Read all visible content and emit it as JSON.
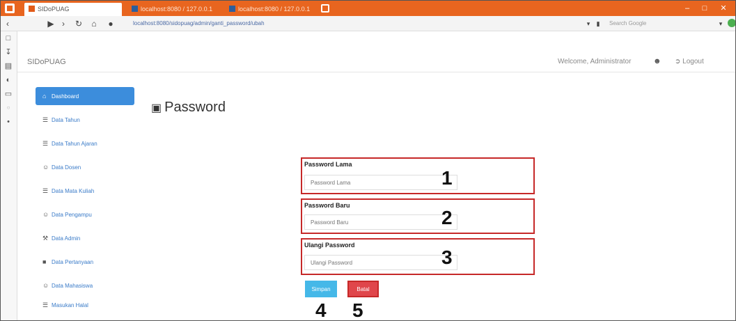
{
  "browser": {
    "tabs": [
      {
        "label": "SIDoPUAG",
        "active": true
      },
      {
        "label": "localhost:8080 / 127.0.0.1",
        "active": false
      },
      {
        "label": "localhost:8080 / 127.0.0.1",
        "active": false
      }
    ],
    "url": "localhost:8080/sidopuag/admin/ganti_password/ubah",
    "search_placeholder": "Search Google"
  },
  "app": {
    "title": "SIDoPUAG",
    "welcome": "Welcome, Administrator",
    "logout_label": "Logout"
  },
  "menu": [
    {
      "label": "Dashboard",
      "icon": "home-icon",
      "glyph": "⌂",
      "active": true
    },
    {
      "label": "Data Tahun",
      "icon": "list-icon",
      "glyph": "☰",
      "active": false
    },
    {
      "label": "Data Tahun Ajaran",
      "icon": "list-icon",
      "glyph": "☰",
      "active": false
    },
    {
      "label": "Data Dosen",
      "icon": "user-icon",
      "glyph": "☺",
      "active": false
    },
    {
      "label": "Data Mata Kuliah",
      "icon": "list-icon",
      "glyph": "☰",
      "active": false
    },
    {
      "label": "Data Pengampu",
      "icon": "user-icon",
      "glyph": "☺",
      "active": false
    },
    {
      "label": "Data Admin",
      "icon": "wrench-icon",
      "glyph": "⚒",
      "active": false
    },
    {
      "label": "Data Pertanyaan",
      "icon": "book-icon",
      "glyph": "■",
      "active": false
    },
    {
      "label": "Data Mahasiswa",
      "icon": "user-icon",
      "glyph": "☺",
      "active": false
    },
    {
      "label": "Masukan Halal",
      "icon": "list-icon",
      "glyph": "☰",
      "active": false
    }
  ],
  "page": {
    "heading": "Password"
  },
  "form": {
    "fields": [
      {
        "label": "Password Lama",
        "placeholder": "Password Lama",
        "annotation": "1"
      },
      {
        "label": "Password Baru",
        "placeholder": "Password Baru",
        "annotation": "2"
      },
      {
        "label": "Ulangi Password",
        "placeholder": "Ulangi Password",
        "annotation": "3"
      }
    ],
    "submit_label": "Simpan",
    "submit_annotation": "4",
    "cancel_label": "Batal",
    "cancel_annotation": "5"
  },
  "colors": {
    "browser_chrome": "#e8651f",
    "active_menu": "#3c8ddc",
    "highlight_box": "#c62828",
    "submit_button": "#45b8e8",
    "cancel_button": "#e0464b"
  }
}
